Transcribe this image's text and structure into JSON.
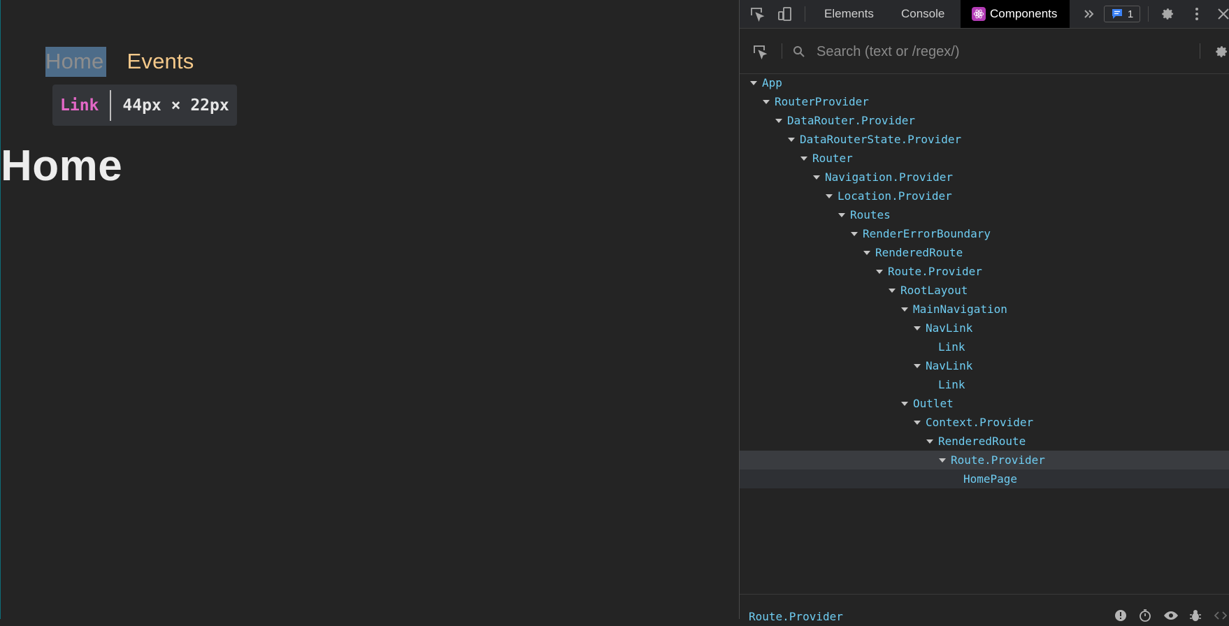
{
  "page": {
    "nav": [
      {
        "label": "Home",
        "active": true
      },
      {
        "label": "Events",
        "active": false
      }
    ],
    "tooltip": {
      "component": "Link",
      "dimensions": "44px × 22px"
    },
    "title": "Home"
  },
  "devtools": {
    "tabs": {
      "elements": "Elements",
      "console": "Console",
      "components": "Components"
    },
    "issues_count": "1",
    "search_placeholder": "Search (text or /regex/)",
    "tree": [
      {
        "label": "App",
        "depth": 0,
        "expanded": true
      },
      {
        "label": "RouterProvider",
        "depth": 1,
        "expanded": true
      },
      {
        "label": "DataRouter.Provider",
        "depth": 2,
        "expanded": true
      },
      {
        "label": "DataRouterState.Provider",
        "depth": 3,
        "expanded": true
      },
      {
        "label": "Router",
        "depth": 4,
        "expanded": true
      },
      {
        "label": "Navigation.Provider",
        "depth": 5,
        "expanded": true
      },
      {
        "label": "Location.Provider",
        "depth": 6,
        "expanded": true
      },
      {
        "label": "Routes",
        "depth": 7,
        "expanded": true
      },
      {
        "label": "RenderErrorBoundary",
        "depth": 8,
        "expanded": true
      },
      {
        "label": "RenderedRoute",
        "depth": 9,
        "expanded": true
      },
      {
        "label": "Route.Provider",
        "depth": 10,
        "expanded": true
      },
      {
        "label": "RootLayout",
        "depth": 11,
        "expanded": true
      },
      {
        "label": "MainNavigation",
        "depth": 12,
        "expanded": true
      },
      {
        "label": "NavLink",
        "depth": 13,
        "expanded": true
      },
      {
        "label": "Link",
        "depth": 14,
        "expanded": false
      },
      {
        "label": "NavLink",
        "depth": 13,
        "expanded": true
      },
      {
        "label": "Link",
        "depth": 14,
        "expanded": false
      },
      {
        "label": "Outlet",
        "depth": 12,
        "expanded": true
      },
      {
        "label": "Context.Provider",
        "depth": 13,
        "expanded": true
      },
      {
        "label": "RenderedRoute",
        "depth": 14,
        "expanded": true
      },
      {
        "label": "Route.Provider",
        "depth": 15,
        "expanded": true,
        "selected": true
      },
      {
        "label": "HomePage",
        "depth": 16,
        "expanded": false,
        "hover": true
      }
    ],
    "selected_component": "Route.Provider"
  },
  "colors": {
    "nav_link": "#f5c98a",
    "tree_text": "#6fcdf2",
    "tooltip_component": "#e368c7"
  }
}
